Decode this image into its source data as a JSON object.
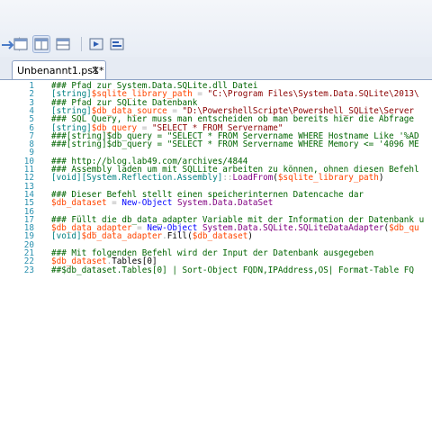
{
  "tab": {
    "title": "Unbenannt1.ps1*",
    "close": "✕"
  },
  "lines": [
    {
      "n": "1",
      "tokens": [
        {
          "c": "c",
          "t": "### Pfad zur System.Data.SQLite.dll Datei"
        }
      ]
    },
    {
      "n": "2",
      "tokens": [
        {
          "c": "t",
          "t": "[string]"
        },
        {
          "c": "v",
          "t": "$sqlite_library_path"
        },
        {
          "c": "o",
          "t": " = "
        },
        {
          "c": "s",
          "t": "\"C:\\Program Files\\System.Data.SQLite\\2013\\"
        }
      ]
    },
    {
      "n": "3",
      "tokens": [
        {
          "c": "c",
          "t": "### Pfad zur SQLite Datenbank"
        }
      ]
    },
    {
      "n": "4",
      "tokens": [
        {
          "c": "t",
          "t": "[string]"
        },
        {
          "c": "v",
          "t": "$db_data_source"
        },
        {
          "c": "o",
          "t": " = "
        },
        {
          "c": "s",
          "t": "\"D:\\PowershellScripte\\Powershell_SQLite\\Server"
        }
      ]
    },
    {
      "n": "5",
      "tokens": [
        {
          "c": "c",
          "t": "### SQL Query, hier muss man entscheiden ob man bereits hier die Abfrage"
        }
      ]
    },
    {
      "n": "6",
      "tokens": [
        {
          "c": "t",
          "t": "[string]"
        },
        {
          "c": "v",
          "t": "$db_query"
        },
        {
          "c": "o",
          "t": " = "
        },
        {
          "c": "s",
          "t": "\"SELECT * FROM Servername\""
        }
      ]
    },
    {
      "n": "7",
      "tokens": [
        {
          "c": "c",
          "t": "###[string]$db_query = \"SELECT * FROM Servername WHERE Hostname Like '%AD"
        }
      ]
    },
    {
      "n": "8",
      "tokens": [
        {
          "c": "c",
          "t": "###[string]$db_query = \"SELECT * FROM Servername WHERE Memory <= '4096 ME"
        }
      ]
    },
    {
      "n": "9",
      "tokens": []
    },
    {
      "n": "10",
      "tokens": [
        {
          "c": "c",
          "t": "### http://blog.lab49.com/archives/4844"
        }
      ]
    },
    {
      "n": "11",
      "tokens": [
        {
          "c": "c",
          "t": "### Assembly laden um mit SQLLite arbeiten zu können, ohnen diesen Befehl"
        }
      ]
    },
    {
      "n": "12",
      "tokens": [
        {
          "c": "t",
          "t": "[void][System.Reflection.Assembly]"
        },
        {
          "c": "o",
          "t": "::"
        },
        {
          "c": "m",
          "t": "LoadFrom"
        },
        {
          "c": "pn",
          "t": "("
        },
        {
          "c": "v",
          "t": "$sqlite_library_path"
        },
        {
          "c": "pn",
          "t": ")"
        }
      ]
    },
    {
      "n": "13",
      "tokens": []
    },
    {
      "n": "14",
      "tokens": [
        {
          "c": "c",
          "t": "### Dieser Befehl stellt einen speicherinternen Datencache dar"
        }
      ]
    },
    {
      "n": "15",
      "tokens": [
        {
          "c": "v",
          "t": "$db_dataset"
        },
        {
          "c": "o",
          "t": " = "
        },
        {
          "c": "k",
          "t": "New-Object"
        },
        {
          "c": "p",
          "t": " "
        },
        {
          "c": "m",
          "t": "System.Data.DataSet"
        }
      ]
    },
    {
      "n": "16",
      "tokens": []
    },
    {
      "n": "17",
      "tokens": [
        {
          "c": "c",
          "t": "### Füllt die db_data_adapter Variable mit der Information der Datenbank u"
        }
      ]
    },
    {
      "n": "18",
      "tokens": [
        {
          "c": "v",
          "t": "$db_data_adapter"
        },
        {
          "c": "o",
          "t": " = "
        },
        {
          "c": "k",
          "t": "New-Object"
        },
        {
          "c": "p",
          "t": " "
        },
        {
          "c": "m",
          "t": "System.Data.SQLite.SQLiteDataAdapter"
        },
        {
          "c": "pn",
          "t": "("
        },
        {
          "c": "v",
          "t": "$db_qu"
        }
      ]
    },
    {
      "n": "19",
      "tokens": [
        {
          "c": "t",
          "t": "[void]"
        },
        {
          "c": "v",
          "t": "$db_data_adapter"
        },
        {
          "c": "o",
          "t": "."
        },
        {
          "c": "p",
          "t": "Fill"
        },
        {
          "c": "pn",
          "t": "("
        },
        {
          "c": "v",
          "t": "$db_dataset"
        },
        {
          "c": "pn",
          "t": ")"
        }
      ]
    },
    {
      "n": "20",
      "tokens": []
    },
    {
      "n": "21",
      "tokens": [
        {
          "c": "c",
          "t": "### Mit folgenden Befehl wird der Input der Datenbank ausgegeben"
        }
      ]
    },
    {
      "n": "22",
      "tokens": [
        {
          "c": "v",
          "t": "$db_dataset"
        },
        {
          "c": "o",
          "t": "."
        },
        {
          "c": "p",
          "t": "Tables"
        },
        {
          "c": "pn",
          "t": "[0]"
        }
      ]
    },
    {
      "n": "23",
      "tokens": [
        {
          "c": "c",
          "t": "##$db_dataset.Tables[0] | Sort-Object FQDN,IPAddress,OS| Format-Table FQ"
        }
      ]
    }
  ],
  "toolbar_icons": [
    "undo-icon",
    "layout-single-icon",
    "layout-split-vertical-icon",
    "layout-split-horizontal-icon",
    "run-script-icon",
    "run-selection-icon"
  ]
}
